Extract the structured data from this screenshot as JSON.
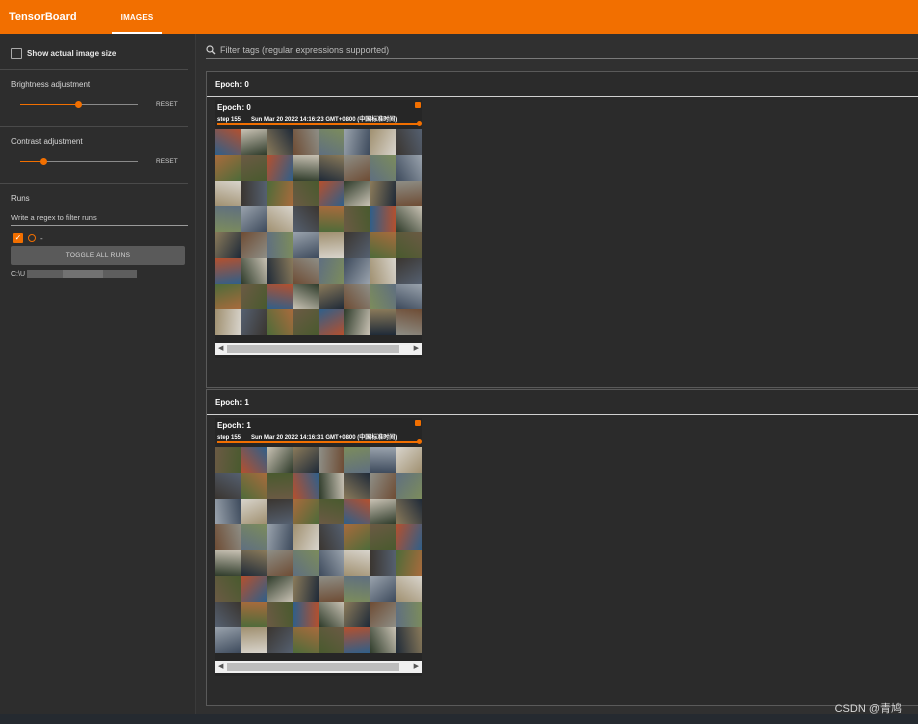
{
  "app": {
    "brand": "TensorBoard",
    "active_tab": "IMAGES"
  },
  "sidebar": {
    "show_actual_size_label": "Show actual image size",
    "brightness": {
      "label": "Brightness adjustment",
      "reset": "RESET",
      "value_fraction": 0.5
    },
    "contrast": {
      "label": "Contrast adjustment",
      "reset": "RESET",
      "value_fraction": 0.2
    },
    "runs_title": "Runs",
    "regex_placeholder": "Write a regex to filter runs",
    "run_name": "-",
    "toggle_label": "TOGGLE ALL RUNS",
    "path_prefix": "C:\\U"
  },
  "filter": {
    "placeholder": "Filter tags (regular expressions supported)"
  },
  "groups": [
    {
      "title": "Epoch:  0",
      "card_title": "Epoch:  0",
      "step": "step 155",
      "time": "Sun Mar 20 2022 14:16:23 GMT+0800 (中国标准时间)"
    },
    {
      "title": "Epoch:  1",
      "card_title": "Epoch:  1",
      "step": "step 155",
      "time": "Sun Mar 20 2022 14:16:31 GMT+0800 (中国标准时间)"
    }
  ],
  "scroll": {
    "left": "◀",
    "right": "▶"
  },
  "watermark": "CSDN @青鸠",
  "colors": {
    "accent": "#f26f00",
    "background": "#303030"
  }
}
